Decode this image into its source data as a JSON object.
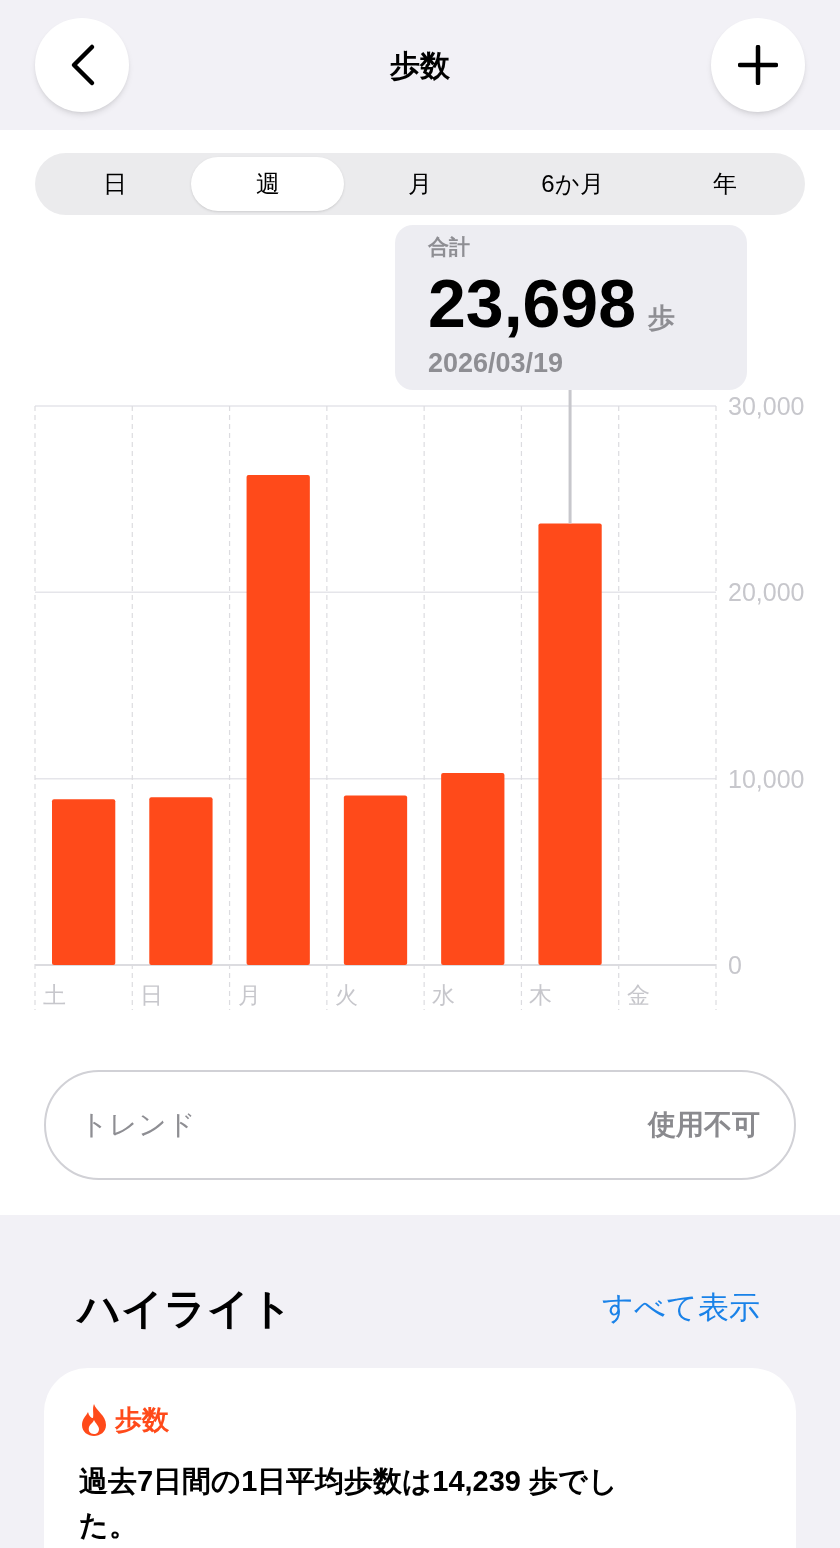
{
  "header": {
    "title": "歩数"
  },
  "periods": [
    {
      "label": "日",
      "selected": false
    },
    {
      "label": "週",
      "selected": true
    },
    {
      "label": "月",
      "selected": false
    },
    {
      "label": "6か月",
      "selected": false
    },
    {
      "label": "年",
      "selected": false
    }
  ],
  "callout": {
    "label": "合計",
    "value": "23,698",
    "unit": "歩",
    "date": "2026/03/19"
  },
  "chart_data": {
    "type": "bar",
    "categories": [
      "土",
      "日",
      "月",
      "火",
      "水",
      "木",
      "金"
    ],
    "series": [
      {
        "color": "#ff4a1a",
        "values": [
          8900,
          9000,
          26300,
          9100,
          10300,
          23700,
          null
        ]
      }
    ],
    "ylim": [
      0,
      30000
    ],
    "yticks": [
      {
        "value": 0,
        "label": "0"
      },
      {
        "value": 10000,
        "label": "10,000"
      },
      {
        "value": 20000,
        "label": "20,000"
      },
      {
        "value": 30000,
        "label": "30,000"
      }
    ]
  },
  "trend": {
    "label": "トレンド",
    "value": "使用不可"
  },
  "highlights": {
    "title": "ハイライト",
    "link": "すべて表示",
    "card": {
      "category": "歩数",
      "text": "過去7日間の1日平均歩数は14,239 歩でした。"
    }
  }
}
